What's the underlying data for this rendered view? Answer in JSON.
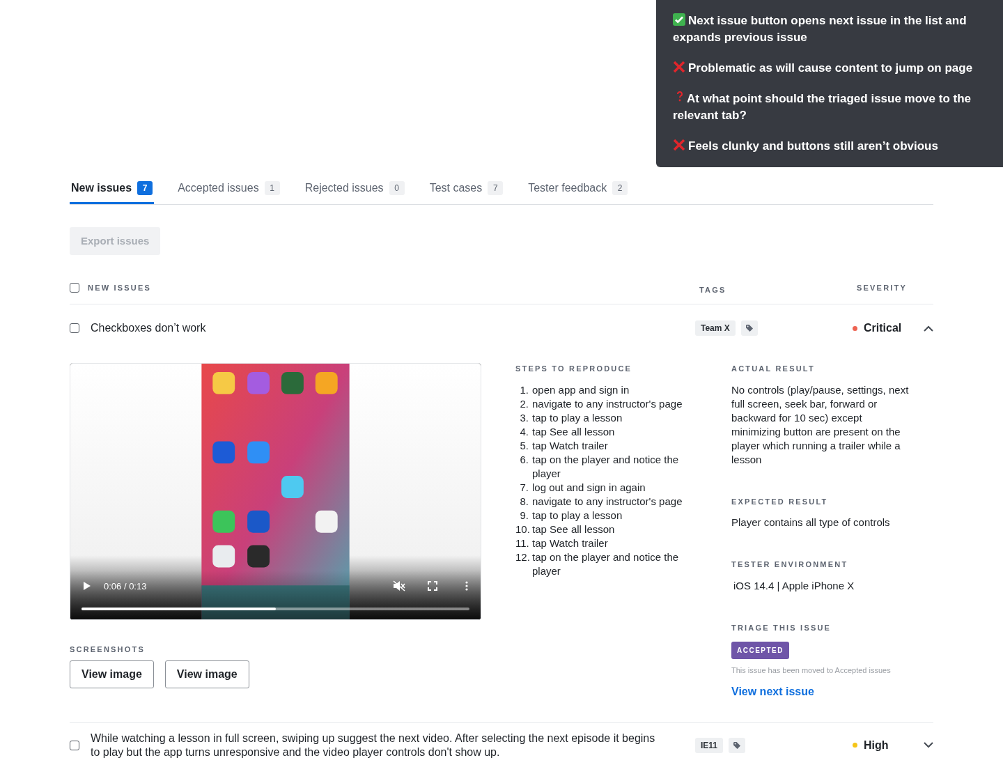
{
  "notes": [
    {
      "kind": "check",
      "text": "Next issue button opens next issue in the list and expands previous issue"
    },
    {
      "kind": "cross",
      "text": "Problematic as will cause content to jump on page"
    },
    {
      "kind": "question",
      "text": "At what point should the triaged issue move to the relevant tab?"
    },
    {
      "kind": "cross",
      "text": "Feels clunky and buttons still aren’t obvious"
    }
  ],
  "tabs": [
    {
      "label": "New issues",
      "count": "7",
      "selected": true
    },
    {
      "label": "Accepted issues",
      "count": "1",
      "selected": false
    },
    {
      "label": "Rejected issues",
      "count": "0",
      "selected": false
    },
    {
      "label": "Test cases",
      "count": "7",
      "selected": false
    },
    {
      "label": "Tester feedback",
      "count": "2",
      "selected": false
    }
  ],
  "export_button": {
    "label": "Export issues",
    "disabled": true
  },
  "list_header": {
    "checked": false,
    "title": "NEW ISSUES",
    "tags": "TAGS",
    "severity": "SEVERITY"
  },
  "issues": [
    {
      "title": "Checkboxes don’t work",
      "checked": false,
      "tags": [
        "Team X"
      ],
      "severity": {
        "label": "Critical",
        "color": "#ee6352"
      },
      "expanded": true,
      "details": {
        "video": {
          "time": "0:06 / 0:13",
          "level": 0.5
        },
        "screenshots_heading": "SCREENSHOTS",
        "screenshots": [
          "View image",
          "View image"
        ],
        "steps_heading": "STEPS TO REPRODUCE",
        "steps": [
          {
            "number": "1.",
            "text": "open app and sign in"
          },
          {
            "number": "2.",
            "text": "navigate to any instructor's page"
          },
          {
            "number": "3.",
            "text": "tap to play a lesson"
          },
          {
            "number": "4.",
            "text": "tap See all lesson"
          },
          {
            "number": "5.",
            "text": "tap Watch trailer"
          },
          {
            "number": "6.",
            "text": "tap on the player and notice the player"
          },
          {
            "number": "7.",
            "text": "log out and sign in again"
          },
          {
            "number": "8.",
            "text": "navigate to any instructor's page"
          },
          {
            "number": "9.",
            "text": "tap to play a lesson"
          },
          {
            "number": "10.",
            "text": "tap See all lesson"
          },
          {
            "number": "11.",
            "text": "tap Watch trailer"
          },
          {
            "number": "12.",
            "text": "tap on the player and notice the player"
          }
        ],
        "actual_heading": "ACTUAL RESULT",
        "actual": "No controls (play/pause, settings, next full screen, seek bar, forward or backward for 10 sec) except minimizing button are present on the player which running a trailer while a lesson",
        "expected_heading": "EXPECTED RESULT",
        "expected": "Player contains all type of controls",
        "env_heading": "TESTER ENVIRONMENT",
        "env": "iOS 14.4 | Apple iPhone X",
        "triage_heading": "TRIAGE THIS ISSUE",
        "triage_status": "ACCEPTED",
        "triage_note": "This issue has been moved to Accepted issues",
        "next_link": "View next issue"
      }
    },
    {
      "title": "While watching a lesson in full screen, swiping up suggest the next video. After selecting the next episode it begins to play but the app turns unresponsive and the video player controls don't show up.",
      "checked": false,
      "tags": [
        "IE11"
      ],
      "severity": {
        "label": "High",
        "color": "#f5c518"
      },
      "expanded": false
    }
  ]
}
